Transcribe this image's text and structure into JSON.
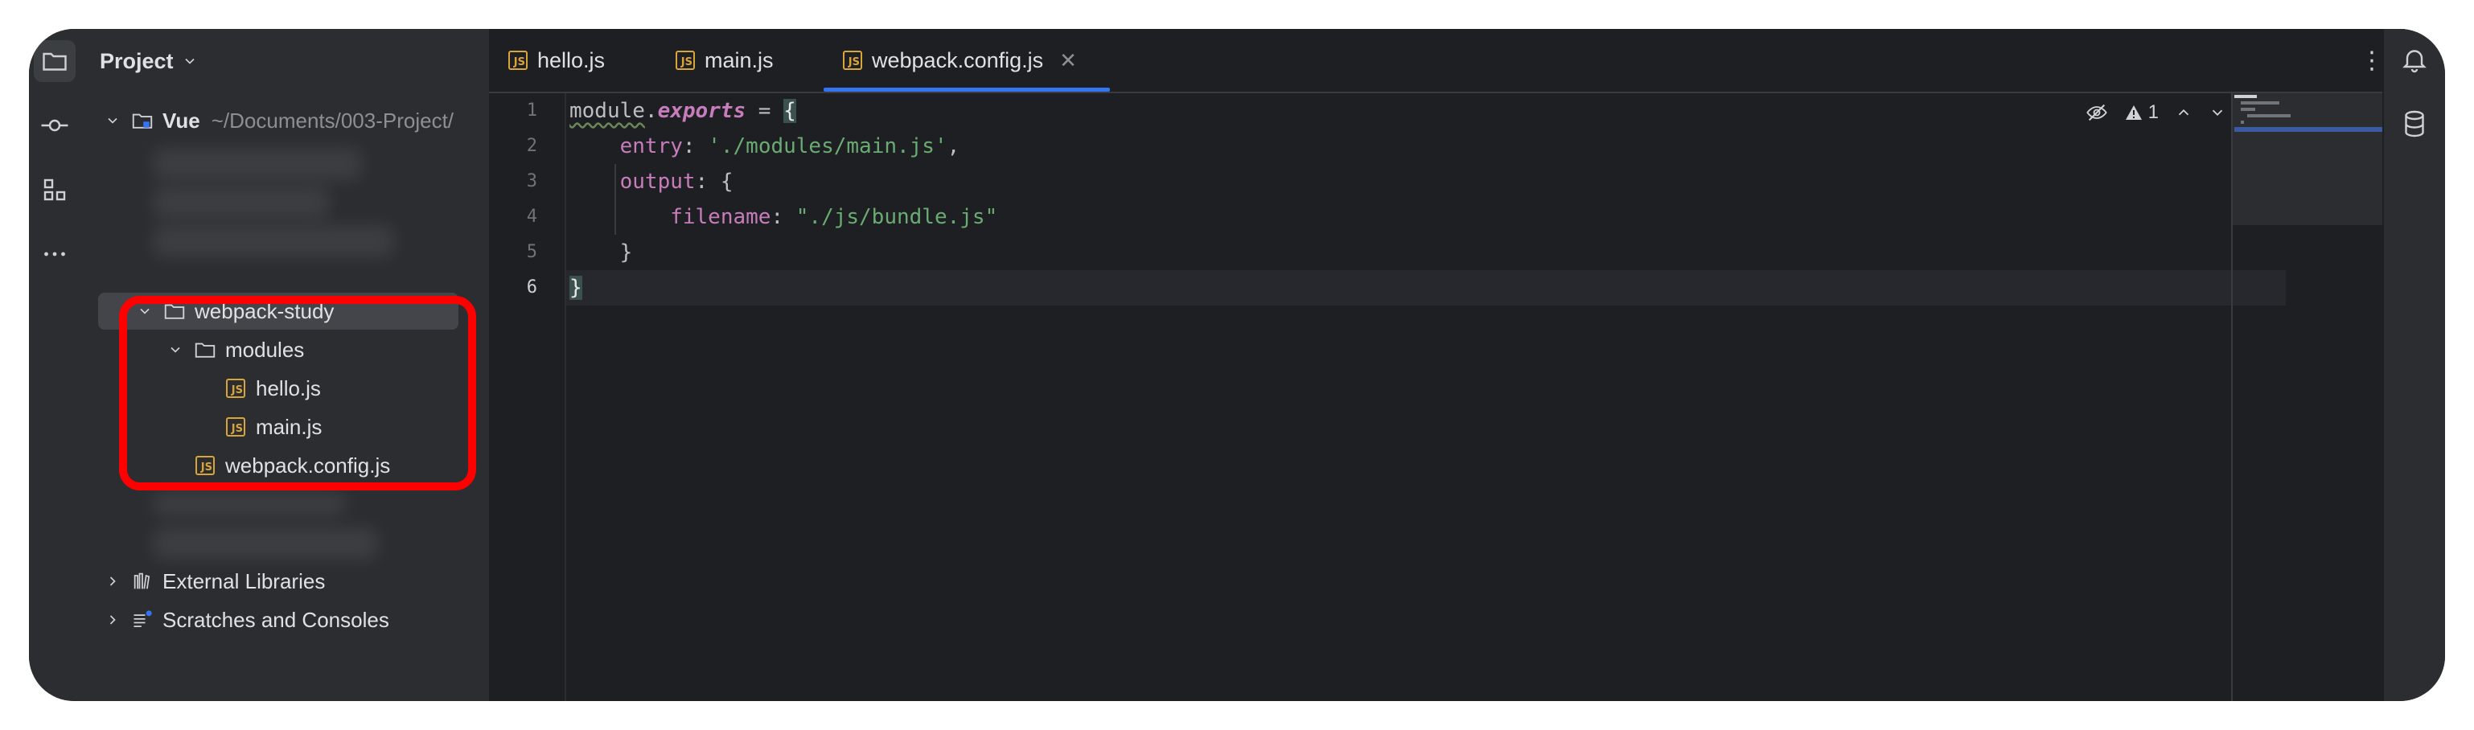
{
  "project_panel": {
    "title": "Project",
    "root": {
      "name": "Vue",
      "path": "~/Documents/003-Project/"
    },
    "tree": [
      {
        "label": "webpack-study",
        "type": "folder"
      },
      {
        "label": "modules",
        "type": "folder"
      },
      {
        "label": "hello.js",
        "type": "js"
      },
      {
        "label": "main.js",
        "type": "js"
      },
      {
        "label": "webpack.config.js",
        "type": "js"
      },
      {
        "label": "External Libraries",
        "type": "library"
      },
      {
        "label": "Scratches and Consoles",
        "type": "scratch"
      }
    ]
  },
  "tabs": [
    {
      "label": "hello.js"
    },
    {
      "label": "main.js"
    },
    {
      "label": "webpack.config.js",
      "active": true
    }
  ],
  "file_badge": "JS",
  "editor": {
    "line_numbers": [
      "1",
      "2",
      "3",
      "4",
      "5",
      "6"
    ],
    "code": {
      "l1_a": "module",
      "l1_b": ".",
      "l1_c": "exports",
      "l1_d": " = ",
      "l1_e": "{",
      "l2_a": "    entry",
      "l2_b": ": ",
      "l2_c": "'./modules/main.js'",
      "l2_d": ",",
      "l3_a": "    output",
      "l3_b": ": {",
      "l4_a": "        filename",
      "l4_b": ": ",
      "l4_c": "\"./js/bundle.js\"",
      "l5_a": "    }",
      "l6_a": "}"
    },
    "warning_count": "1"
  },
  "colors": {
    "accent": "#3574f0",
    "js_badge": "#d9a53b",
    "highlight_box": "#ff0000"
  }
}
